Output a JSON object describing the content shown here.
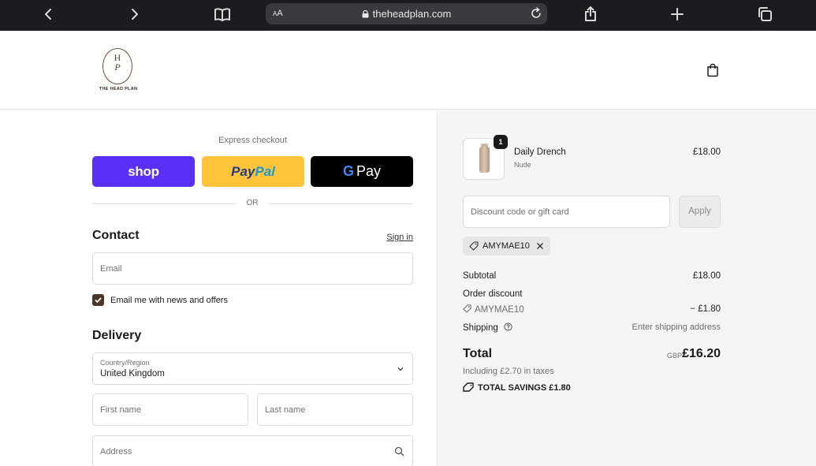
{
  "browser": {
    "text_size_label": "AA",
    "url": "theheadplan.com"
  },
  "site": {
    "logo_letters": "H",
    "logo_script": "P",
    "logo_name": "THE HEAD PLAN"
  },
  "checkout": {
    "express_label": "Express checkout",
    "shop_pay_label": "shop",
    "paypal_label_1": "Pay",
    "paypal_label_2": "Pal",
    "gpay_g": "G",
    "gpay_label": "Pay",
    "or_label": "OR",
    "contact": {
      "title": "Contact",
      "sign_in": "Sign in",
      "email_placeholder": "Email",
      "newsletter_label": "Email me with news and offers",
      "newsletter_checked": true
    },
    "delivery": {
      "title": "Delivery",
      "country_label": "Country/Region",
      "country_value": "United Kingdom",
      "first_name_placeholder": "First name",
      "last_name_placeholder": "Last name",
      "address_placeholder": "Address"
    }
  },
  "summary": {
    "item": {
      "quantity": "1",
      "name": "Daily Drench",
      "variant": "Nude",
      "price": "£18.00"
    },
    "discount_placeholder": "Discount code or gift card",
    "apply_label": "Apply",
    "applied_code": "AMYMAE10",
    "subtotal_label": "Subtotal",
    "subtotal_value": "£18.00",
    "order_discount_label": "Order discount",
    "order_discount_code": "AMYMAE10",
    "order_discount_value": "− £1.80",
    "shipping_label": "Shipping",
    "shipping_value": "Enter shipping address",
    "total_label": "Total",
    "total_currency": "GBP",
    "total_value": "£16.20",
    "taxes_note": "Including £2.70 in taxes",
    "savings_label": "TOTAL SAVINGS",
    "savings_value": "£1.80"
  },
  "colors": {
    "shop_pay": "#5a31f4",
    "paypal": "#ffc439",
    "checkbox": "#4a3628"
  }
}
